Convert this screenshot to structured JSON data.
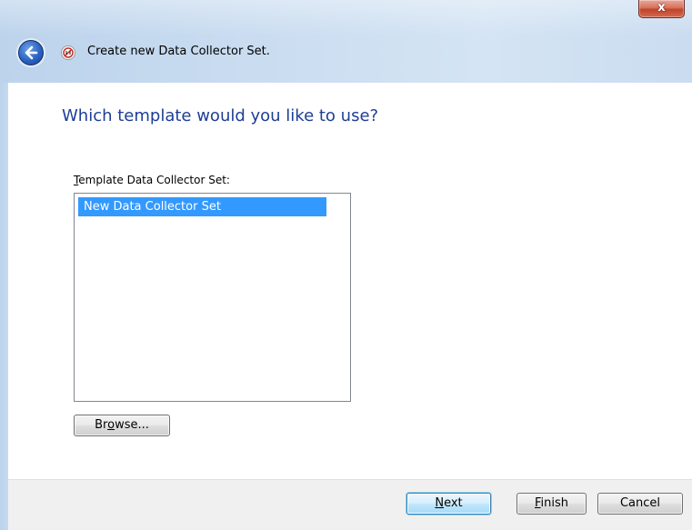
{
  "window": {
    "title": "Create new Data Collector Set.",
    "close_label": "x"
  },
  "page": {
    "heading": "Which template would you like to use?"
  },
  "template_list": {
    "label_mnemonic": "T",
    "label_rest": "emplate Data Collector Set:",
    "items": [
      {
        "label": "New Data Collector Set",
        "selected": true
      }
    ],
    "selection_color": "#3399ff"
  },
  "buttons": {
    "browse": {
      "before": "Br",
      "mnemonic": "o",
      "after": "wse..."
    },
    "next": {
      "mnemonic": "N",
      "after": "ext"
    },
    "finish": {
      "mnemonic": "F",
      "after": "inish"
    },
    "cancel": {
      "label": "Cancel"
    }
  },
  "colors": {
    "heading": "#1e3e96",
    "frame": "#c9dcf0",
    "footer": "#f0f0f0"
  }
}
